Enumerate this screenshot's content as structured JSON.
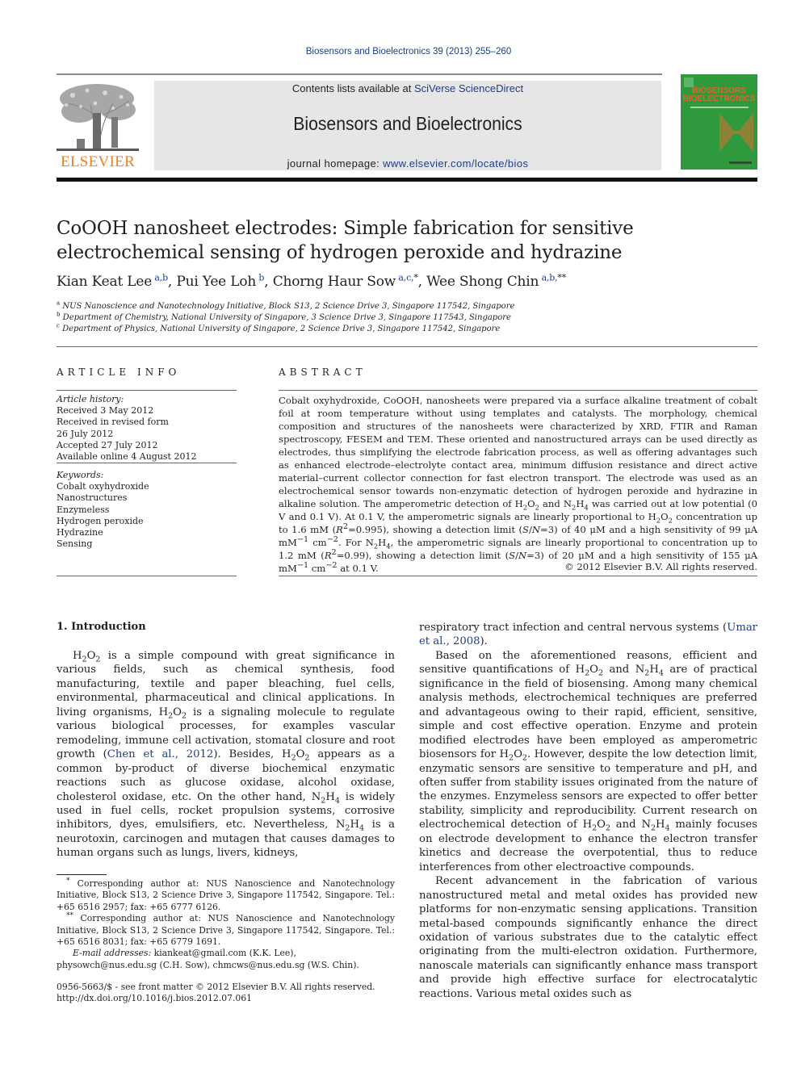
{
  "header": {
    "journal_ref": "Biosensors and Bioelectronics 39 (2013) 255–260",
    "contents_prefix": "Contents lists available at ",
    "contents_link": "SciVerse ScienceDirect",
    "journal_name": "Biosensors and Bioelectronics",
    "homepage_prefix": "journal homepage: ",
    "homepage_link": "www.elsevier.com/locate/bios",
    "publisher_logo_text": "ELSEVIER",
    "cover_title_line1": "BIOSENSORS",
    "cover_title_line2": "BIOELECTRONICS",
    "colors": {
      "elsevier_orange": "#f07f1e",
      "link_blue": "#1d3c8f",
      "cover_green": "#2f9a3d",
      "cover_orange": "#e0642c"
    }
  },
  "article": {
    "title": "CoOOH nanosheet electrodes: Simple fabrication for sensitive electrochemical sensing of hydrogen peroxide and hydrazine",
    "authors": [
      {
        "name": "Kian Keat Lee",
        "sup": "a,b",
        "mark": ""
      },
      {
        "name": "Pui Yee Loh",
        "sup": "b",
        "mark": ""
      },
      {
        "name": "Chorng Haur Sow",
        "sup": "a,c,",
        "mark": "*"
      },
      {
        "name": "Wee Shong Chin",
        "sup": "a,b,",
        "mark": "**"
      }
    ],
    "affiliations": [
      {
        "key": "a",
        "text": "NUS Nanoscience and Nanotechnology Initiative, Block S13, 2 Science Drive 3, Singapore 117542, Singapore"
      },
      {
        "key": "b",
        "text": "Department of Chemistry, National University of Singapore, 3 Science Drive 3, Singapore 117543, Singapore"
      },
      {
        "key": "c",
        "text": "Department of Physics, National University of Singapore, 2 Science Drive 3, Singapore 117542, Singapore"
      }
    ]
  },
  "article_info": {
    "heading": "ARTICLE INFO",
    "history_label": "Article history:",
    "history": [
      "Received 3 May 2012",
      "Received in revised form",
      "26 July 2012",
      "Accepted 27 July 2012",
      "Available online 4 August 2012"
    ],
    "keywords_label": "Keywords:",
    "keywords": [
      "Cobalt oxyhydroxide",
      "Nanostructures",
      "Enzymeless",
      "Hydrogen peroxide",
      "Hydrazine",
      "Sensing"
    ]
  },
  "abstract": {
    "heading": "ABSTRACT",
    "s1": "Cobalt oxyhydroxide, CoOOH, nanosheets were prepared via a surface alkaline treatment of cobalt foil at room temperature without using templates and catalysts. The morphology, chemical composition and structures of the nanosheets were characterized by XRD, FTIR and Raman spectroscopy, FESEM and TEM. These oriented and nanostructured arrays can be used directly as electrodes, thus simplifying the electrode fabrication process, as well as offering advantages such as enhanced electrode–electrolyte contact area, minimum diffusion resistance and direct active material–current collector connection for fast electron transport. The electrode was used as an electrochemical sensor towards non-enzymatic detection of hydrogen peroxide and hydrazine in alkaline solution. The amperometric detection of ",
    "s2": " was carried out at low potential (0 V and 0.1 V). At 0.1 V, the amperometric signals are linearly proportional to ",
    "s3": " concentration up to 1.6 mM (",
    "s4": "=0.995), showing a detection limit (",
    "s5": "=3) of 40 μM and a high sensitivity of 99 μA mM",
    "s6": " cm",
    "s7": ". For ",
    "s8": ", the amperometric signals are linearly proportional to concentration up to 1.2 mM (",
    "s9": "=0.99), showing a detection limit (",
    "s10": "=3) of 20 μM and a high sensitivity of 155 μA mM",
    "s11": " at 0.1 V.",
    "copyright": "© 2012 Elsevier B.V. All rights reserved."
  },
  "chem": {
    "H": "H",
    "O": "O",
    "N": "N",
    "two": "2",
    "four": "4",
    "and": " and ",
    "R": "R",
    "S": "S",
    "N_it": "N",
    "slash": "/",
    "minus1": "−1",
    "minus2": "−2"
  },
  "intro": {
    "heading": "1.   Introduction",
    "p1_a": " is a simple compound with great significance in various fields, such as chemical synthesis, food manufacturing, textile and paper bleaching, fuel cells, environmental, pharmaceutical and clinical applications. In living organisms, ",
    "p1_b": " is a signaling molecule to regulate various biological processes, for examples vascular remodeling, immune cell activation, stomatal closure and root growth (",
    "p1_cite1": "Chen et al., 2012",
    "p1_c": "). Besides, ",
    "p1_d": " appears as a common by-product of diverse biochemical enzymatic reactions such as glucose oxidase, alcohol oxidase, cholesterol oxidase, etc. On the other hand, ",
    "p1_e": " is widely used in fuel cells, rocket propulsion systems, corrosive inhibitors, dyes, emulsifiers, etc. Nevertheless, ",
    "p1_f": " is a neurotoxin, carcinogen and mutagen that causes damages to human organs such as lungs, livers, kidneys, respiratory tract infection and central nervous systems (",
    "p1_cite2": "Umar et al., 2008",
    "p1_g": ").",
    "p2_a": "Based on the aforementioned reasons, efficient and sensitive quantifications of ",
    "p2_b": " are of practical significance in the field of biosensing. Among many chemical analysis methods, electrochemical techniques are preferred and advantageous owing to their rapid, efficient, sensitive, simple and cost effective operation. Enzyme and protein modified electrodes have been employed as amperometric biosensors for ",
    "p2_c": ". However, despite the low detection limit, enzymatic sensors are sensitive to temperature and pH, and often suffer from stability issues originated from the nature of the enzymes. Enzymeless sensors are expected to offer better stability, simplicity and reproducibility. Current research on electrochemical detection of ",
    "p2_d": " mainly focuses on electrode development to enhance the electron transfer kinetics and decrease the overpotential, thus to reduce interferences from other electroactive compounds.",
    "p3": "Recent advancement in the fabrication of various nanostructured metal and metal oxides has provided new platforms for non-enzymatic sensing applications. Transition metal-based compounds significantly enhance the direct oxidation of various substrates due to the catalytic effect originating from the multi-electron oxidation. Furthermore, nanoscale materials can significantly enhance mass transport and provide high effective surface for electrocatalytic reactions. Various metal oxides such as"
  },
  "footnotes": {
    "fn1_mark": "*",
    "fn1": " Corresponding author at: NUS Nanoscience and Nanotechnology Initiative, Block S13, 2 Science Drive 3, Singapore 117542, Singapore. Tel.: +65 6516 2957; fax: +65 6777 6126.",
    "fn2_mark": "**",
    "fn2": " Corresponding author at: NUS Nanoscience and Nanotechnology Initiative, Block S13, 2 Science Drive 3, Singapore 117542, Singapore. Tel.: +65 6516 8031; fax: +65 6779 1691.",
    "email_label": "E-mail addresses:",
    "email1": "kiankeat@gmail.com",
    "email1_who": " (K.K. Lee),",
    "email2": "physowch@nus.edu.sg",
    "email2_who": " (C.H. Sow), ",
    "email3": "chmcws@nus.edu.sg",
    "email3_who": " (W.S. Chin).",
    "front_matter": "0956-5663/$ - see front matter © 2012 Elsevier B.V. All rights reserved.",
    "doi": "http://dx.doi.org/10.1016/j.bios.2012.07.061"
  }
}
